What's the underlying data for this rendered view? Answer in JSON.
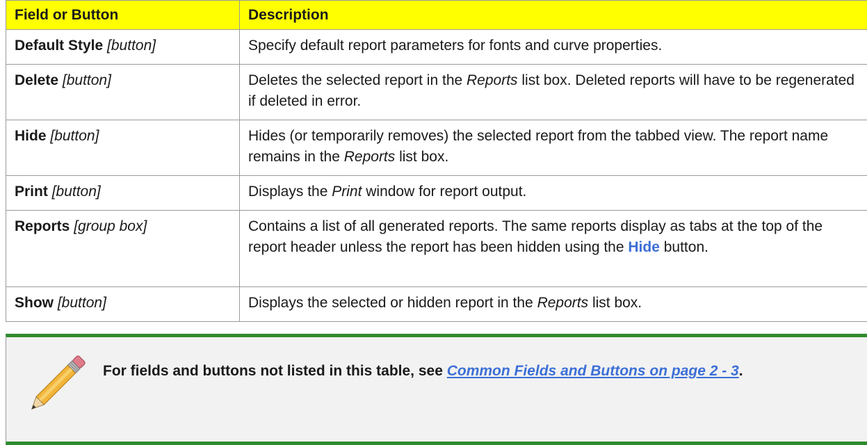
{
  "table": {
    "headers": [
      "Field or Button",
      "Description"
    ],
    "rows": [
      {
        "field": "Default Style",
        "type": "[button]",
        "desc": [
          "Specify default report parameters for fonts and curve properties."
        ]
      },
      {
        "field": "Delete",
        "type": "[button]",
        "desc": [
          "Deletes the selected report in the ",
          "Reports",
          " list box. Deleted reports will have to be regenerated if deleted in error."
        ]
      },
      {
        "field": "Hide",
        "type": "[button]",
        "desc": [
          "Hides (or temporarily removes) the selected report from the tabbed view. The report name remains in the ",
          "Reports",
          " list box."
        ]
      },
      {
        "field": "Print",
        "type": "[button]",
        "desc": [
          "Displays the ",
          "Print",
          " window for report output."
        ]
      },
      {
        "field": "Reports",
        "type": "[group box]",
        "desc": [
          "Contains a list of all generated reports. The same reports display as tabs at the top of the report header unless the report has been hidden using the ",
          "Hide",
          " button."
        ]
      },
      {
        "field": "Show",
        "type": "[button]",
        "desc": [
          "Displays the selected or hidden report in the ",
          "Reports",
          " list box."
        ]
      }
    ]
  },
  "note": {
    "icon": "pencil-icon",
    "prefix": "For fields and buttons not listed in this table, see ",
    "link": "Common Fields and Buttons on page 2 - 3",
    "suffix": "."
  },
  "colors": {
    "header_bg": "#ffff00",
    "note_bar": "#2e8b2e",
    "link": "#3c6fd6",
    "note_bg": "#f2f2f2"
  }
}
